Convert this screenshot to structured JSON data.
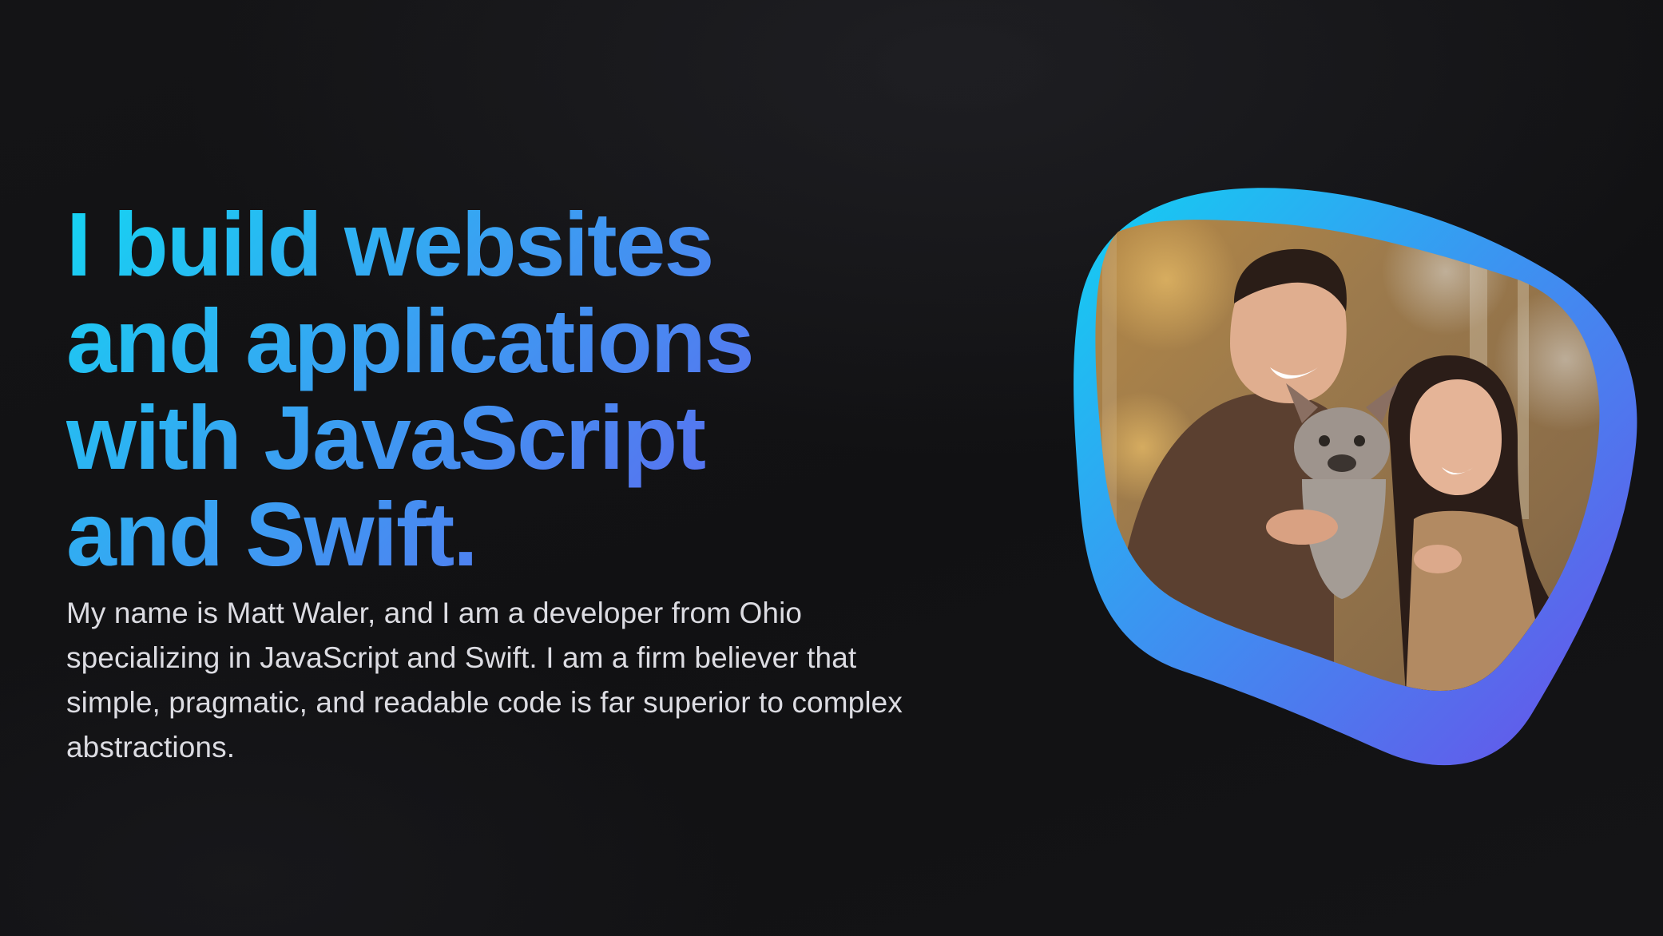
{
  "hero": {
    "headline_lines": [
      "I build websites",
      "and applications",
      "with JavaScript",
      "and Swift."
    ],
    "intro": "My name is Matt Waler, and I am a developer from Ohio specializing in JavaScript and Swift. I am a firm believer that simple, pragmatic, and readable code is far superior to complex abstractions."
  },
  "photo": {
    "subject": "photo-portrait-couple-with-dog"
  },
  "colors": {
    "background": "#111113",
    "gradient_start": "#15d4f2",
    "gradient_end": "#6561ee",
    "body_text": "#dcdce2"
  }
}
